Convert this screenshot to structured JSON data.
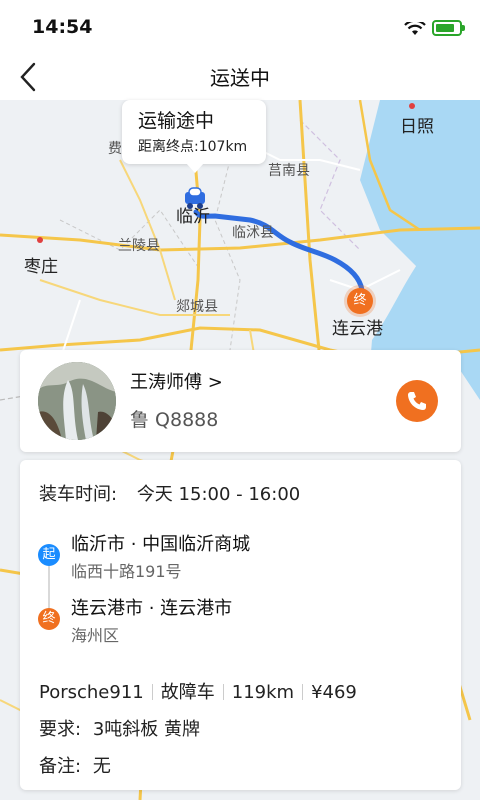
{
  "status": {
    "time": "14:54"
  },
  "nav": {
    "title": "运送中"
  },
  "map": {
    "labels": [
      "日照",
      "莒南县",
      "临沂",
      "临沭县",
      "兰陵县",
      "枣庄",
      "郯城县",
      "连云港",
      "费"
    ],
    "bubble": {
      "title": "运输途中",
      "distance": "距离终点:107km"
    },
    "end_pin": "终",
    "colors": {
      "route": "#2f6de0",
      "road": "#f5c64a",
      "water": "#a9d8f4"
    }
  },
  "driver": {
    "name": "王涛师傅 >",
    "plate": "鲁 Q8888"
  },
  "order": {
    "load_time_label": "装车时间:",
    "load_time_value": "今天 15:00 - 16:00",
    "start_badge": "起",
    "start_place": "临沂市 · 中国临沂商城",
    "start_addr": "临西十路191号",
    "end_badge": "终",
    "end_place": "连云港市 · 连云港市",
    "end_addr": "海州区",
    "vehicle": "Porsche911",
    "vehicle_status": "故障车",
    "distance": "119km",
    "price": "¥469",
    "requirement_label": "要求:",
    "requirement_value": "3吨斜板 黄牌",
    "remark_label": "备注:",
    "remark_value": "无"
  },
  "accent_color": "#f07020",
  "start_color": "#1a8cff"
}
